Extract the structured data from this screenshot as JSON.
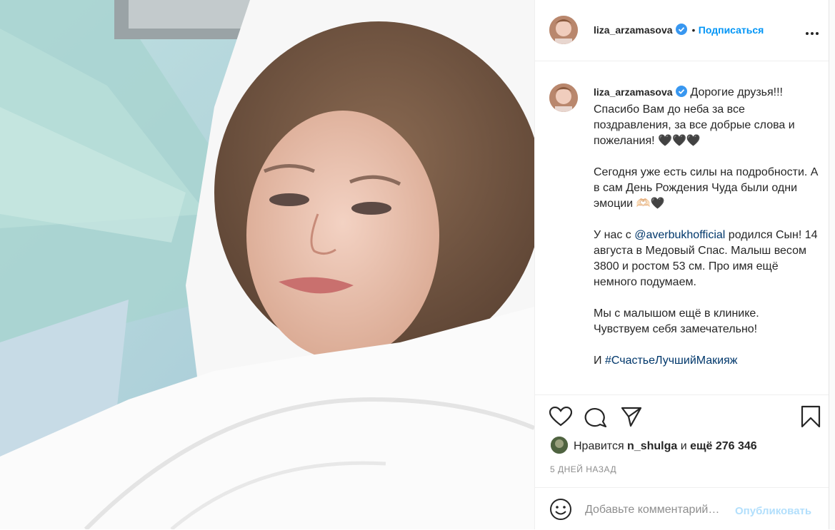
{
  "post": {
    "username": "liza_arzamasova",
    "dot": "•",
    "follow_label": "Подписаться",
    "more_icon": "more-horizontal-icon"
  },
  "caption": {
    "username": "liza_arzamasova",
    "p1": "Дорогие друзья!!!\nСпасибо Вам до неба за все поздравления, за все добрые слова и пожелания! 🖤🖤🖤",
    "p2": "Сегодня уже есть силы на подробности. А в сам День Рождения Чуда были одни эмоции 🫶🏻🖤",
    "p3_prefix": "У нас с ",
    "p3_mention": "@averbukhofficial",
    "p3_suffix": " родился Сын! 14 августа в Медовый Спас. Малыш весом 3800 и ростом 53 см. Про имя ещё немного подумаем.",
    "p4": "Мы с малышом ещё в клинике.\nЧувствуем себя замечательно!",
    "p5_prefix": "И ",
    "p5_hashtag": "#СчастьеЛучшийМакияж"
  },
  "likes": {
    "prefix": "Нравится ",
    "user": "n_shulga",
    "middle": " и ",
    "count": "ещё 276 346"
  },
  "date": "5 ДНЕЙ НАЗАД",
  "comment": {
    "placeholder": "Добавьте комментарий…",
    "publish_label": "Опубликовать"
  },
  "colors": {
    "link": "#0095f6",
    "verified": "#3897f0",
    "muted": "#8e8e8e"
  }
}
